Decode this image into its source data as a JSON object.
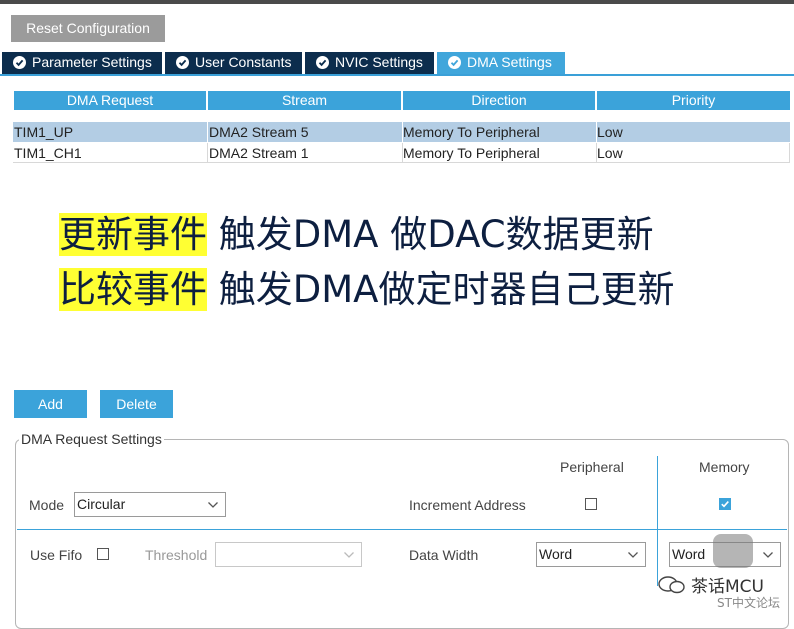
{
  "toolbar": {
    "reset_label": "Reset Configuration"
  },
  "tabs": [
    {
      "label": "Parameter Settings",
      "active": false
    },
    {
      "label": "User Constants",
      "active": false
    },
    {
      "label": "NVIC Settings",
      "active": false
    },
    {
      "label": "DMA Settings",
      "active": true
    }
  ],
  "table": {
    "headers": [
      "DMA Request",
      "Stream",
      "Direction",
      "Priority"
    ],
    "rows": [
      {
        "request": "TIM1_UP",
        "stream": "DMA2 Stream 5",
        "direction": "Memory To Peripheral",
        "priority": "Low",
        "selected": true
      },
      {
        "request": "TIM1_CH1",
        "stream": "DMA2 Stream 1",
        "direction": "Memory To Peripheral",
        "priority": "Low",
        "selected": false
      }
    ]
  },
  "annotation": {
    "line1_highlight": "更新事件",
    "line1_text": " 触发DMA 做DAC数据更新",
    "line2_highlight": "比较事件",
    "line2_text": " 触发DMA做定时器自己更新"
  },
  "actions": {
    "add_label": "Add",
    "delete_label": "Delete"
  },
  "settings": {
    "legend": "DMA Request Settings",
    "peripheral_header": "Peripheral",
    "memory_header": "Memory",
    "mode_label": "Mode",
    "mode_value": "Circular",
    "increment_label": "Increment Address",
    "increment_peripheral": false,
    "increment_memory": true,
    "fifo_label": "Use Fifo",
    "use_fifo": false,
    "threshold_label": "Threshold",
    "threshold_value": "",
    "data_width_label": "Data Width",
    "peripheral_width": "Word",
    "memory_width": "Word"
  },
  "watermark": {
    "line1": "茶话MCU",
    "line2": "ST中文论坛"
  },
  "colors": {
    "accent": "#3ba3da",
    "tab_dark": "#0c2d4d",
    "selected_row": "#b3cde4",
    "highlight": "#ffff33"
  }
}
